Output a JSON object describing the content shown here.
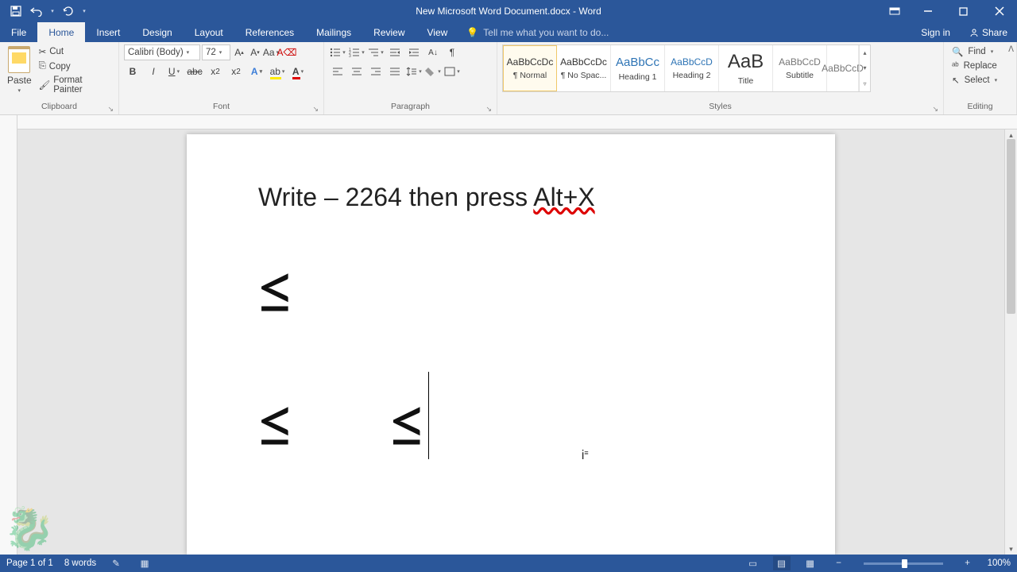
{
  "titlebar": {
    "doc_title": "New Microsoft Word Document.docx - Word"
  },
  "tabs": {
    "file": "File",
    "home": "Home",
    "insert": "Insert",
    "design": "Design",
    "layout": "Layout",
    "references": "References",
    "mailings": "Mailings",
    "review": "Review",
    "view": "View",
    "tell_me": "Tell me what you want to do...",
    "sign_in": "Sign in",
    "share": "Share"
  },
  "ribbon": {
    "clipboard": {
      "label": "Clipboard",
      "paste": "Paste",
      "cut": "Cut",
      "copy": "Copy",
      "format_painter": "Format Painter"
    },
    "font": {
      "label": "Font",
      "family": "Calibri (Body)",
      "size": "72"
    },
    "paragraph": {
      "label": "Paragraph"
    },
    "styles": {
      "label": "Styles",
      "items": [
        {
          "preview": "AaBbCcDc",
          "name": "¶ Normal",
          "cls": ""
        },
        {
          "preview": "AaBbCcDc",
          "name": "¶ No Spac...",
          "cls": ""
        },
        {
          "preview": "AaBbCc",
          "name": "Heading 1",
          "cls": "h"
        },
        {
          "preview": "AaBbCcD",
          "name": "Heading 2",
          "cls": "h"
        },
        {
          "preview": "AaB",
          "name": "Title",
          "cls": ""
        },
        {
          "preview": "AaBbCcD",
          "name": "Subtitle",
          "cls": ""
        },
        {
          "preview": "AaBbCcD",
          "name": "",
          "cls": ""
        }
      ]
    },
    "editing": {
      "label": "Editing",
      "find": "Find",
      "replace": "Replace",
      "select": "Select"
    }
  },
  "document": {
    "line1_a": "Write – 2264 then press ",
    "line1_b": "Alt+X",
    "sym1": "≤",
    "sym2": "≤",
    "sym3": "≤"
  },
  "status": {
    "page": "Page 1 of 1",
    "words": "8 words",
    "zoom": "100%"
  }
}
